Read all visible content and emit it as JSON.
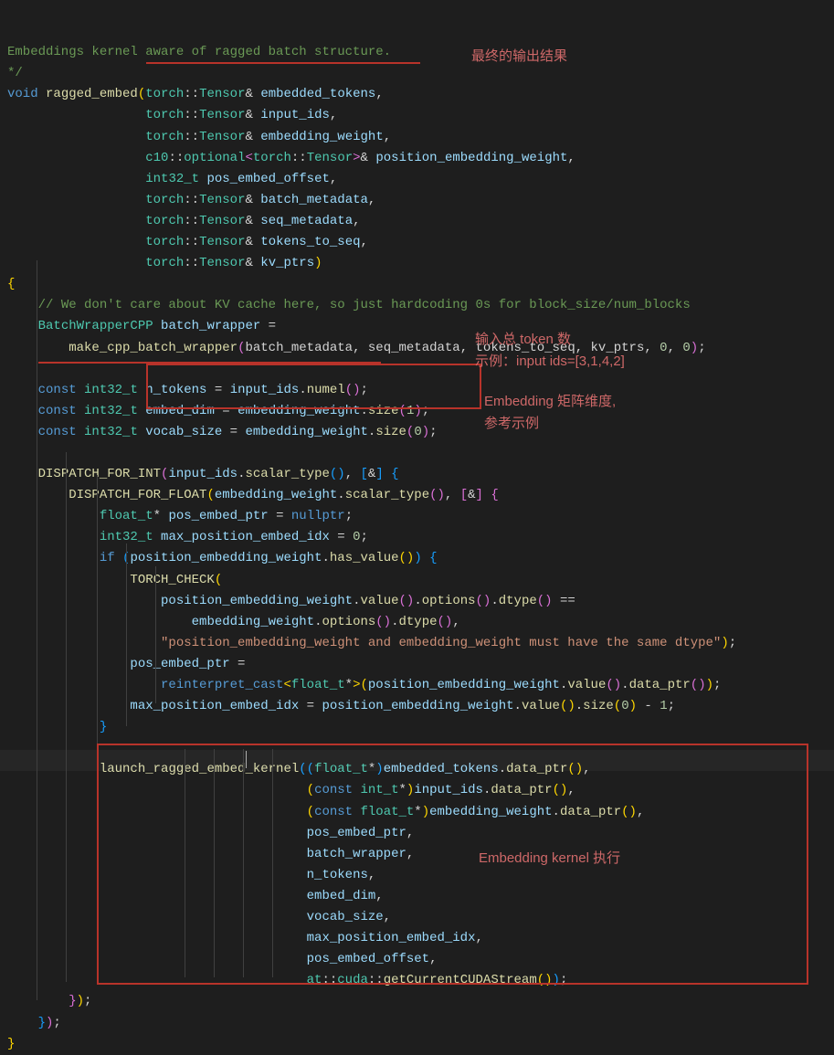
{
  "code": {
    "l1": "Embeddings kernel aware of ragged batch structure.",
    "l2": "*/",
    "l3_void": "void",
    "l3_func": "ragged_embed",
    "l3_ns": "torch",
    "l3_type": "Tensor",
    "l3_amp": "&",
    "l3_p": "embedded_tokens",
    "l4_p": "input_ids",
    "l5_p": "embedding_weight",
    "l6_ns": "c10",
    "l6_opt": "optional",
    "l6_p": "position_embedding_weight",
    "l7_t": "int32_t",
    "l7_p": "pos_embed_offset",
    "l8_p": "batch_metadata",
    "l9_p": "seq_metadata",
    "l10_p": "tokens_to_seq",
    "l11_p": "kv_ptrs",
    "l13_c": "// We don't care about KV cache here, so just hardcoding 0s for block_size/num_blocks",
    "l14_t": "BatchWrapperCPP",
    "l14_v": "batch_wrapper",
    "l15_f": "make_cpp_batch_wrapper",
    "l15_a": "batch_metadata, seq_metadata, tokens_to_seq, kv_ptrs, ",
    "l15_z1": "0",
    "l15_z2": "0",
    "l17_k": "const",
    "l17_v": "n_tokens",
    "l17_f": "numel",
    "l18_v": "embed_dim",
    "l18_f": "size",
    "l18_n": "1",
    "l19_v": "vocab_size",
    "l19_n": "0",
    "l21_f": "DISPATCH_FOR_INT",
    "l21_m": "scalar_type",
    "l22_f": "DISPATCH_FOR_FLOAT",
    "l23_t": "float_t",
    "l23_v": "pos_embed_ptr",
    "l23_n": "nullptr",
    "l24_v": "max_position_embed_idx",
    "l24_n": "0",
    "l25_k": "if",
    "l25_f": "has_value",
    "l26_f": "TORCH_CHECK",
    "l27_f1": "value",
    "l27_f2": "options",
    "l27_f3": "dtype",
    "l29_s": "\"position_embedding_weight and embedding_weight must have the same dtype\"",
    "l31_f": "reinterpret_cast",
    "l31_f2": "data_ptr",
    "l32_n": "1",
    "l35_f": "launch_ragged_embed_kernel",
    "l36_k": "const",
    "l36_t": "int_t",
    "l40_f": "at",
    "l40_f2": "cuda",
    "l40_f3": "getCurrentCUDAStream"
  },
  "annotations": {
    "a1": "最终的输出结果",
    "a2": "输入总 token 数",
    "a3": "示例：input ids=[3,1,4,2]",
    "a4": "Embedding 矩阵维度,",
    "a5": "参考示例",
    "a6": "Embedding kernel 执行"
  }
}
